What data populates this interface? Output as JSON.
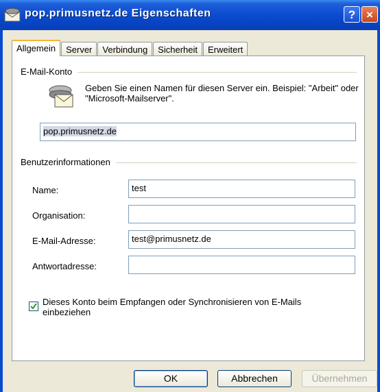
{
  "window": {
    "title": "pop.primusnetz.de Eigenschaften",
    "help_glyph": "?",
    "close_glyph": "×"
  },
  "tabs": [
    {
      "label": "Allgemein",
      "active": true
    },
    {
      "label": "Server",
      "active": false
    },
    {
      "label": "Verbindung",
      "active": false
    },
    {
      "label": "Sicherheit",
      "active": false
    },
    {
      "label": "Erweitert",
      "active": false
    }
  ],
  "account_group": {
    "label": "E-Mail-Konto",
    "description": "Geben Sie einen Namen für diesen Server ein. Beispiel: \"Arbeit\" oder \"Microsoft-Mailserver\".",
    "account_name": "pop.primusnetz.de"
  },
  "user_group": {
    "label": "Benutzerinformationen",
    "name_label": "Name:",
    "name_value": "test",
    "organisation_label": "Organisation:",
    "organisation_value": "",
    "email_label": "E-Mail-Adresse:",
    "email_value": "test@primusnetz.de",
    "reply_label": "Antwortadresse:",
    "reply_value": ""
  },
  "include_account": {
    "checked": true,
    "label": "Dieses Konto beim Empfangen oder Synchronisieren von E-Mails einbeziehen"
  },
  "buttons": {
    "ok": "OK",
    "cancel": "Abbrechen",
    "apply": "Übernehmen"
  },
  "colors": {
    "titlebar": "#0a4bd0",
    "active_tab_accent": "#f8b336",
    "checkbox_check": "#21a121"
  }
}
